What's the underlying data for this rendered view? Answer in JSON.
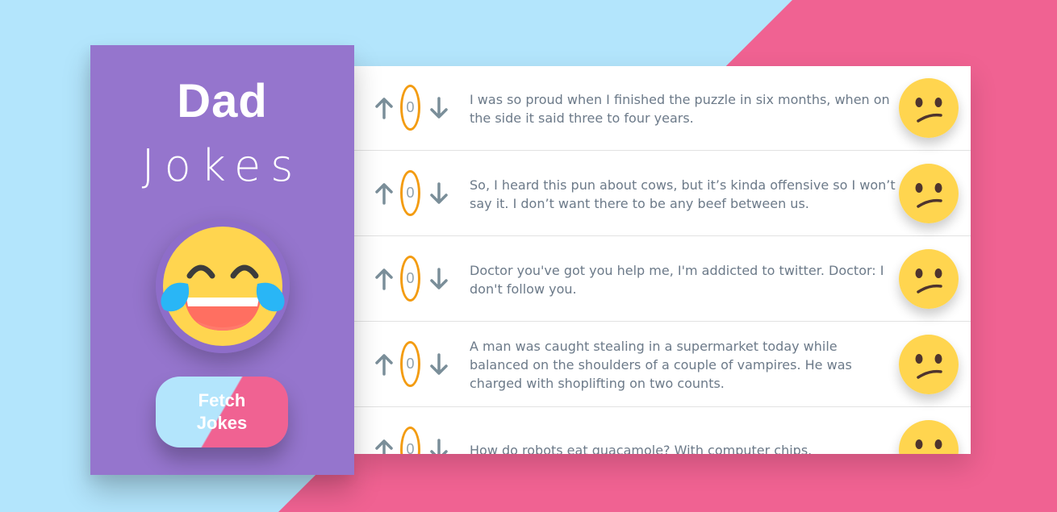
{
  "colors": {
    "background_light_blue": "#b3e5fc",
    "background_pink": "#f06292",
    "sidebar_purple": "#9575cd",
    "vote_ring_orange": "#f39c12",
    "arrow_gray": "#7a8e99",
    "emoji_yellow": "#ffd54f"
  },
  "sidebar": {
    "title_bold": "Dad",
    "title_light": "Jokes",
    "logo_icon": "laughing-tears-emoji-icon",
    "fetch_button_label": "Fetch Jokes"
  },
  "jokes": [
    {
      "votes": "0",
      "text": "I was so proud when I finished the puzzle in six months, when on the side it said three to four years.",
      "emoji_icon": "confused-face-icon"
    },
    {
      "votes": "0",
      "text": "So, I heard this pun about cows, but it’s kinda offensive so I won’t say it. I don’t want there to be any beef between us.",
      "emoji_icon": "confused-face-icon"
    },
    {
      "votes": "0",
      "text": "Doctor you've got you help me, I'm addicted to twitter. Doctor: I don't follow you.",
      "emoji_icon": "confused-face-icon"
    },
    {
      "votes": "0",
      "text": "A man was caught stealing in a supermarket today while balanced on the shoulders of a couple of vampires. He was charged with shoplifting on two counts.",
      "emoji_icon": "confused-face-icon"
    },
    {
      "votes": "0",
      "text": "How do robots eat guacamole? With computer chips.",
      "emoji_icon": "confused-face-icon"
    }
  ]
}
